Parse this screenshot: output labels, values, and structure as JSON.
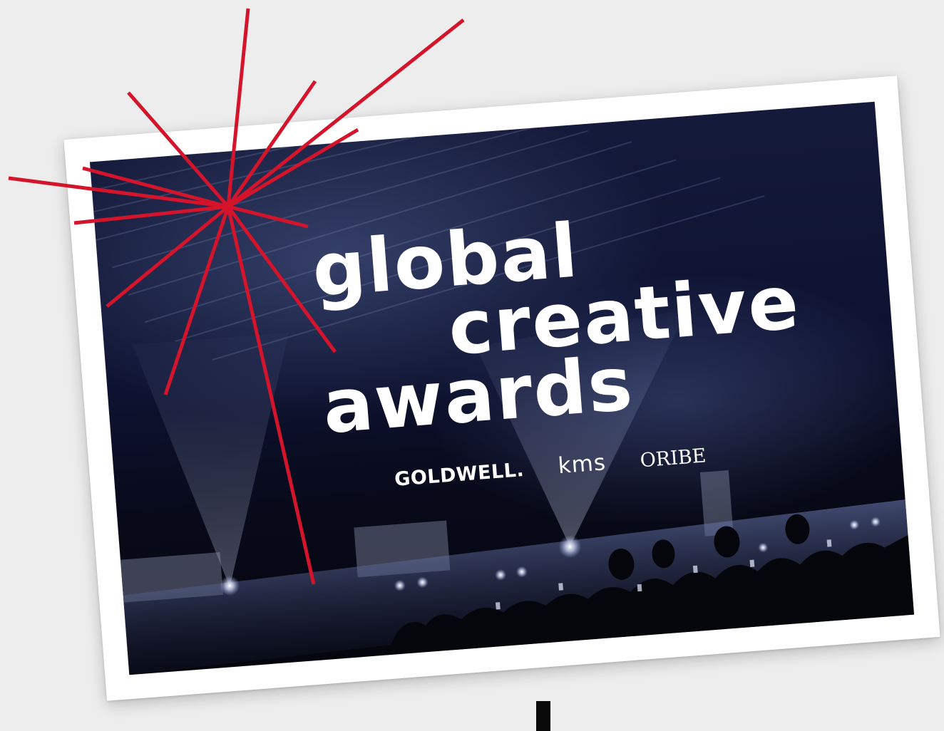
{
  "title": {
    "line1": "global",
    "line2": "creative",
    "line3": "awards"
  },
  "brands": {
    "goldwell": "GOLDWELL.",
    "kms": "kms",
    "oribe": "ORIBE"
  },
  "colors": {
    "background": "#ededed",
    "starburst": "#d4142a",
    "photo_dark": "#0d1230",
    "text": "#ffffff"
  },
  "icons": {
    "starburst": "starburst-icon"
  }
}
